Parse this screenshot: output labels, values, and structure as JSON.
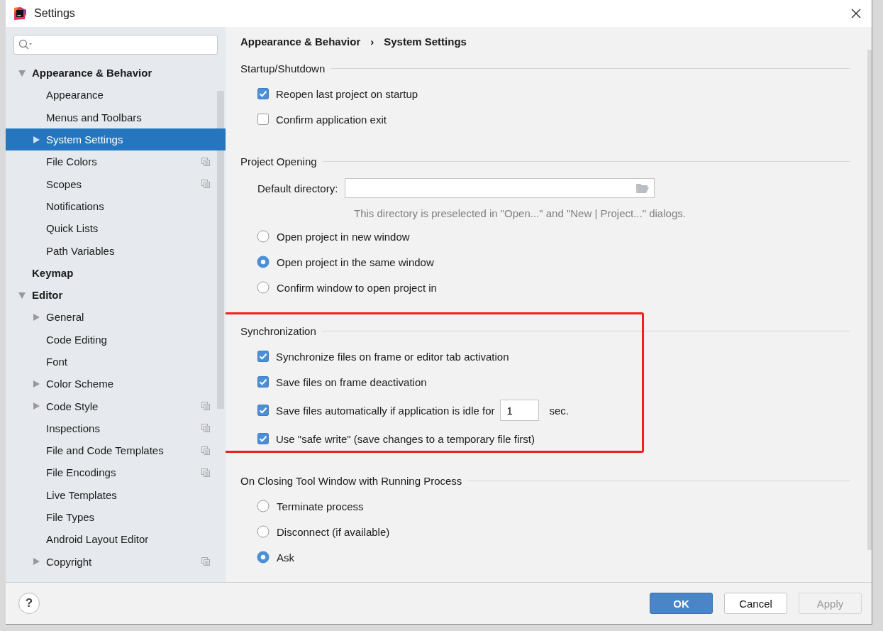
{
  "window": {
    "title": "Settings"
  },
  "sidebar": {
    "items": [
      {
        "label": "Appearance & Behavior",
        "selected": false,
        "expanded": true,
        "children": [
          {
            "label": "Appearance",
            "selected": false
          },
          {
            "label": "Menus and Toolbars",
            "selected": false
          },
          {
            "label": "System Settings",
            "selected": true,
            "expanded": false
          },
          {
            "label": "File Colors",
            "selected": false,
            "per_project": true
          },
          {
            "label": "Scopes",
            "selected": false,
            "per_project": true
          },
          {
            "label": "Notifications",
            "selected": false
          },
          {
            "label": "Quick Lists",
            "selected": false
          },
          {
            "label": "Path Variables",
            "selected": false
          }
        ]
      },
      {
        "label": "Keymap",
        "selected": false
      },
      {
        "label": "Editor",
        "selected": false,
        "expanded": true,
        "children": [
          {
            "label": "General",
            "selected": false,
            "expanded": false
          },
          {
            "label": "Code Editing",
            "selected": false
          },
          {
            "label": "Font",
            "selected": false
          },
          {
            "label": "Color Scheme",
            "selected": false,
            "expanded": false
          },
          {
            "label": "Code Style",
            "selected": false,
            "expanded": false,
            "per_project": true
          },
          {
            "label": "Inspections",
            "selected": false,
            "per_project": true
          },
          {
            "label": "File and Code Templates",
            "selected": false,
            "per_project": true
          },
          {
            "label": "File Encodings",
            "selected": false,
            "per_project": true
          },
          {
            "label": "Live Templates",
            "selected": false
          },
          {
            "label": "File Types",
            "selected": false
          },
          {
            "label": "Android Layout Editor",
            "selected": false
          },
          {
            "label": "Copyright",
            "selected": false,
            "expanded": false,
            "per_project": true
          }
        ]
      }
    ]
  },
  "breadcrumb": [
    "Appearance & Behavior",
    "System Settings"
  ],
  "breadcrumb_separator": "›",
  "sections": [
    {
      "title": "Startup/Shutdown",
      "highlighted": false,
      "items": [
        {
          "kind": "checkbox",
          "label": "Reopen last project on startup",
          "checked": true
        },
        {
          "kind": "checkbox",
          "label": "Confirm application exit",
          "checked": false
        }
      ]
    },
    {
      "title": "Project Opening",
      "highlighted": false,
      "items": [
        {
          "kind": "directory",
          "label": "Default directory:",
          "value": "",
          "hint": "This directory is preselected in \"Open...\" and \"New | Project...\" dialogs."
        },
        {
          "kind": "radio",
          "label": "Open project in new window",
          "selected": false
        },
        {
          "kind": "radio",
          "label": "Open project in the same window",
          "selected": true
        },
        {
          "kind": "radio",
          "label": "Confirm window to open project in",
          "selected": false
        }
      ]
    },
    {
      "title": "Synchronization",
      "highlighted": true,
      "items": [
        {
          "kind": "checkbox",
          "label": "Synchronize files on frame or editor tab activation",
          "checked": true
        },
        {
          "kind": "checkbox",
          "label": "Save files on frame deactivation",
          "checked": true
        },
        {
          "kind": "checkbox_number",
          "label": "Save files automatically if application is idle for",
          "checked": true,
          "value": "1",
          "unit": "sec."
        },
        {
          "kind": "checkbox",
          "label": "Use \"safe write\" (save changes to a temporary file first)",
          "checked": true
        }
      ]
    },
    {
      "title": "On Closing Tool Window with Running Process",
      "highlighted": false,
      "items": [
        {
          "kind": "radio",
          "label": "Terminate process",
          "selected": false
        },
        {
          "kind": "radio",
          "label": "Disconnect (if available)",
          "selected": false
        },
        {
          "kind": "radio",
          "label": "Ask",
          "selected": true
        }
      ]
    }
  ],
  "help_button": "?",
  "buttons": [
    {
      "label": "OK",
      "primary": true,
      "disabled": false
    },
    {
      "label": "Cancel",
      "primary": false,
      "disabled": false
    },
    {
      "label": "Apply",
      "primary": false,
      "disabled": true
    }
  ]
}
